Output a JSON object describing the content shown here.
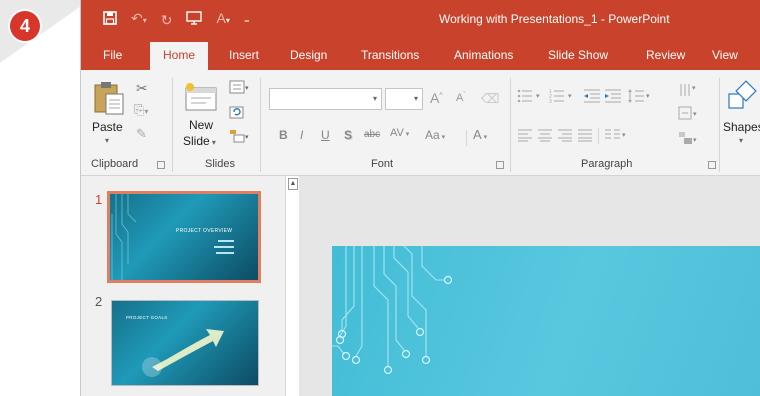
{
  "step_badge": "4",
  "title": "Working with Presentations_1 - PowerPoint",
  "quick_access": {
    "save_icon": "save-icon",
    "undo_icon": "undo-icon",
    "redo_icon": "redo-icon",
    "start_icon": "present-icon",
    "format_icon": "format-painter-icon",
    "customize_icon": "customize-icon"
  },
  "tabs": [
    "File",
    "Home",
    "Insert",
    "Design",
    "Transitions",
    "Animations",
    "Slide Show",
    "Review",
    "View"
  ],
  "active_tab": "Home",
  "ribbon": {
    "clipboard": {
      "paste_label": "Paste",
      "group_label": "Clipboard"
    },
    "slides": {
      "new_slide_label_1": "New",
      "new_slide_label_2": "Slide",
      "group_label": "Slides"
    },
    "font": {
      "bold": "B",
      "italic": "I",
      "underline": "U",
      "shadow": "S",
      "strike": "abc",
      "spacing": "AV",
      "case": "Aa",
      "color": "A",
      "grow": "A",
      "shrink": "A",
      "group_label": "Font"
    },
    "paragraph": {
      "group_label": "Paragraph"
    },
    "drawing": {
      "shapes_label": "Shapes"
    }
  },
  "slides": [
    {
      "number": "1",
      "title": "PROJECT OVERVIEW",
      "selected": true
    },
    {
      "number": "2",
      "title": "PROJECT GOALS",
      "selected": false
    }
  ],
  "colors": {
    "accent": "#c9422b",
    "badge": "#d7362a",
    "selection": "#e07e62",
    "slide_bg": "#4fbfd8"
  }
}
